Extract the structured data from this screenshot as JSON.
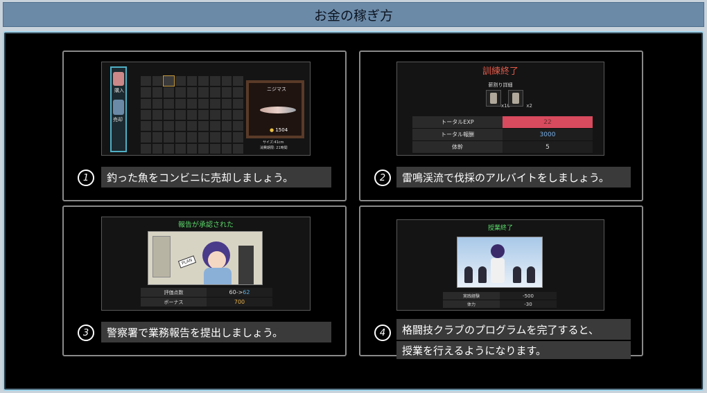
{
  "title": "お金の稼ぎ方",
  "cards": [
    {
      "number": "1",
      "caption": "釣った魚をコンビニに売却しましょう。",
      "shot": {
        "side_label_1": "購入",
        "side_label_2": "売却",
        "fish_name": "ニジマス",
        "price": "1504",
        "info_1": "サイズ:41cm",
        "info_2": "消費期限: 21時間"
      }
    },
    {
      "number": "2",
      "caption": "雷鳴渓流で伐採のアルバイトをしましょう。",
      "shot": {
        "title": "訓練終了",
        "subtitle": "薪割り詳細",
        "item_1_count": "x10",
        "item_2_count": "x2",
        "rows": [
          {
            "key": "トータルEXP",
            "value": "22"
          },
          {
            "key": "トータル報酬",
            "value": "3000"
          },
          {
            "key": "体幹",
            "value": "5"
          }
        ]
      }
    },
    {
      "number": "3",
      "caption": "警察署で業務報告を提出しましょう。",
      "shot": {
        "title": "報告が承認された",
        "tag": "PLAN",
        "row_1_key": "評価点数",
        "row_1_from": "60->",
        "row_1_to": "62",
        "row_2_key": "ボーナス",
        "row_2_value": "700"
      }
    },
    {
      "number": "4",
      "caption_1": "格闘技クラブのプログラムを完了すると、",
      "caption_2": "授業を行えるようになります。",
      "shot": {
        "title": "授業終了",
        "rows": [
          {
            "key": "実践経験",
            "value": "-500"
          },
          {
            "key": "体力",
            "value": "-30"
          }
        ]
      }
    }
  ]
}
